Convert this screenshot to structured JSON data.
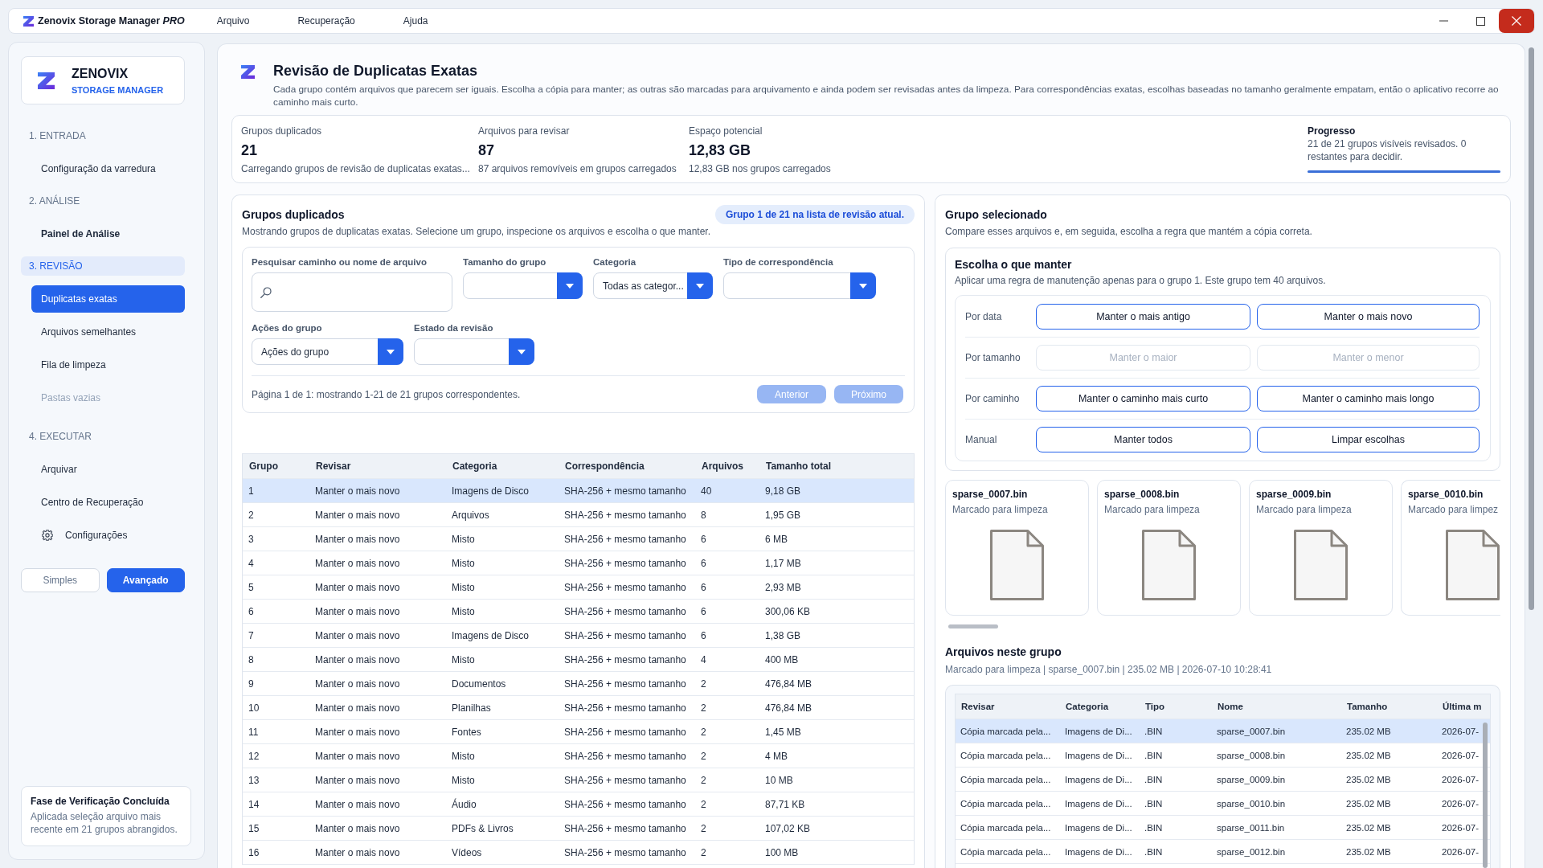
{
  "window": {
    "title": "Zenovix Storage Manager *PRO*",
    "menu": [
      "Arquivo",
      "Recuperação",
      "Ajuda"
    ]
  },
  "sidebar": {
    "brand": {
      "name": "ZENOVIX",
      "tagline": "STORAGE MANAGER"
    },
    "sections": [
      {
        "label": "1. ENTRADA",
        "selected": false,
        "items": [
          {
            "label": "Configuração da varredura",
            "kind": "page",
            "selected": false,
            "disabled": false,
            "emphasized": false
          }
        ]
      },
      {
        "label": "2. ANÁLISE",
        "selected": false,
        "items": [
          {
            "label": "Painel de Análise",
            "kind": "page",
            "selected": false,
            "disabled": false,
            "emphasized": true
          }
        ]
      },
      {
        "label": "3. REVISÃO",
        "selected": true,
        "items": [
          {
            "label": "Duplicatas exatas",
            "kind": "page",
            "selected": true,
            "disabled": false,
            "emphasized": false
          },
          {
            "label": "Arquivos semelhantes",
            "kind": "page",
            "selected": false,
            "disabled": false,
            "emphasized": false
          },
          {
            "label": "Fila de limpeza",
            "kind": "page",
            "selected": false,
            "disabled": false,
            "emphasized": false
          },
          {
            "label": "Pastas vazias",
            "kind": "page",
            "selected": false,
            "disabled": true,
            "emphasized": false
          }
        ]
      },
      {
        "label": "4. EXECUTAR",
        "selected": false,
        "items": [
          {
            "label": "Arquivar",
            "kind": "page",
            "selected": false,
            "disabled": false,
            "emphasized": false
          },
          {
            "label": "Centro de Recuperação",
            "kind": "page",
            "selected": false,
            "disabled": false,
            "emphasized": false
          },
          {
            "label": "Configurações",
            "kind": "settings",
            "selected": false,
            "disabled": false,
            "emphasized": false
          }
        ]
      }
    ],
    "modes": [
      {
        "label": "Simples",
        "selected": false
      },
      {
        "label": "Avançado",
        "selected": true
      }
    ],
    "status_card": {
      "title": "Fase de Verificação Concluída",
      "text": "Aplicada seleção arquivo mais recente em 21 grupos abrangidos."
    }
  },
  "header": {
    "title": "Revisão de Duplicatas Exatas",
    "description": "Cada grupo contém arquivos que parecem ser iguais. Escolha a cópia para manter; as outras são marcadas para arquivamento e ainda podem ser revisadas antes da limpeza. Para correspondências exatas, escolhas baseadas no tamanho geralmente empatam, então o aplicativo recorre ao caminho mais curto."
  },
  "stats": [
    {
      "label": "Grupos duplicados",
      "value": "21",
      "note": "Carregando grupos de revisão de duplicatas exatas..."
    },
    {
      "label": "Arquivos para revisar",
      "value": "87",
      "note": "87 arquivos removíveis em grupos carregados"
    },
    {
      "label": "Espaço potencial",
      "value": "12,83 GB",
      "note": "12,83 GB nos grupos carregados"
    }
  ],
  "progress": {
    "label": "Progresso",
    "text": "21 de 21 grupos visíveis revisados. 0 restantes para decidir.",
    "level": 1
  },
  "groups_panel": {
    "title": "Grupos duplicados",
    "badge": "Grupo 1 de 21 na lista de revisão atual.",
    "description": "Mostrando grupos de duplicatas exatas. Selecione um grupo, inspecione os arquivos e escolha o que manter.",
    "filters": [
      {
        "label": "Pesquisar caminho ou nome de arquivo",
        "kind": "search"
      },
      {
        "label": "Tamanho do grupo",
        "kind": "dropdown"
      },
      {
        "label": "Categoria",
        "kind": "dropdown",
        "value": "Todas as categor..."
      },
      {
        "label": "Tipo de correspondência",
        "kind": "dropdown"
      },
      {
        "label": "Ações do grupo",
        "kind": "dropdown",
        "value": "Ações do grupo"
      },
      {
        "label": "Estado da revisão",
        "kind": "dropdown"
      }
    ],
    "page_info": "Página 1 de 1: mostrando 1-21 de 21 grupos correspondentes.",
    "pager": [
      {
        "label": "Anterior",
        "disabled": true
      },
      {
        "label": "Próximo",
        "disabled": true
      }
    ],
    "table": {
      "columns": [
        "Grupo",
        "Revisar",
        "Categoria",
        "Correspondência",
        "Arquivos",
        "Tamanho total"
      ],
      "rows": [
        {
          "selected": true,
          "cells": [
            "1",
            "Manter o mais novo",
            "Imagens de Disco",
            "SHA-256 + mesmo tamanho",
            "40",
            "9,18 GB"
          ]
        },
        {
          "selected": false,
          "cells": [
            "2",
            "Manter o mais novo",
            "Arquivos",
            "SHA-256 + mesmo tamanho",
            "8",
            "1,95 GB"
          ]
        },
        {
          "selected": false,
          "cells": [
            "3",
            "Manter o mais novo",
            "Misto",
            "SHA-256 + mesmo tamanho",
            "6",
            "6 MB"
          ]
        },
        {
          "selected": false,
          "cells": [
            "4",
            "Manter o mais novo",
            "Misto",
            "SHA-256 + mesmo tamanho",
            "6",
            "1,17 MB"
          ]
        },
        {
          "selected": false,
          "cells": [
            "5",
            "Manter o mais novo",
            "Misto",
            "SHA-256 + mesmo tamanho",
            "6",
            "2,93 MB"
          ]
        },
        {
          "selected": false,
          "cells": [
            "6",
            "Manter o mais novo",
            "Misto",
            "SHA-256 + mesmo tamanho",
            "6",
            "300,06 KB"
          ]
        },
        {
          "selected": false,
          "cells": [
            "7",
            "Manter o mais novo",
            "Imagens de Disco",
            "SHA-256 + mesmo tamanho",
            "6",
            "1,38 GB"
          ]
        },
        {
          "selected": false,
          "cells": [
            "8",
            "Manter o mais novo",
            "Misto",
            "SHA-256 + mesmo tamanho",
            "4",
            "400 MB"
          ]
        },
        {
          "selected": false,
          "cells": [
            "9",
            "Manter o mais novo",
            "Documentos",
            "SHA-256 + mesmo tamanho",
            "2",
            "476,84 MB"
          ]
        },
        {
          "selected": false,
          "cells": [
            "10",
            "Manter o mais novo",
            "Planilhas",
            "SHA-256 + mesmo tamanho",
            "2",
            "476,84 MB"
          ]
        },
        {
          "selected": false,
          "cells": [
            "11",
            "Manter o mais novo",
            "Fontes",
            "SHA-256 + mesmo tamanho",
            "2",
            "1,45 MB"
          ]
        },
        {
          "selected": false,
          "cells": [
            "12",
            "Manter o mais novo",
            "Misto",
            "SHA-256 + mesmo tamanho",
            "2",
            "4 MB"
          ]
        },
        {
          "selected": false,
          "cells": [
            "13",
            "Manter o mais novo",
            "Misto",
            "SHA-256 + mesmo tamanho",
            "2",
            "10 MB"
          ]
        },
        {
          "selected": false,
          "cells": [
            "14",
            "Manter o mais novo",
            "Áudio",
            "SHA-256 + mesmo tamanho",
            "2",
            "87,71 KB"
          ]
        },
        {
          "selected": false,
          "cells": [
            "15",
            "Manter o mais novo",
            "PDFs & Livros",
            "SHA-256 + mesmo tamanho",
            "2",
            "107,02 KB"
          ]
        },
        {
          "selected": false,
          "cells": [
            "16",
            "Manter o mais novo",
            "Vídeos",
            "SHA-256 + mesmo tamanho",
            "2",
            "100 MB"
          ]
        }
      ]
    }
  },
  "selected_group": {
    "title": "Grupo selecionado",
    "description": "Compare esses arquivos e, em seguida, escolha a regra que mantém a cópia correta.",
    "keep": {
      "title": "Escolha o que manter",
      "description": "Aplicar uma regra de manutenção apenas para o grupo 1. Este grupo tem 40 arquivos.",
      "rules": [
        {
          "label": "Por data",
          "options": [
            {
              "label": "Manter o mais antigo",
              "disabled": false
            },
            {
              "label": "Manter o mais novo",
              "disabled": false
            }
          ]
        },
        {
          "label": "Por tamanho",
          "options": [
            {
              "label": "Manter o maior",
              "disabled": true
            },
            {
              "label": "Manter o menor",
              "disabled": true
            }
          ]
        },
        {
          "label": "Por caminho",
          "options": [
            {
              "label": "Manter o caminho mais curto",
              "disabled": false
            },
            {
              "label": "Manter o caminho mais longo",
              "disabled": false
            }
          ]
        },
        {
          "label": "Manual",
          "options": [
            {
              "label": "Manter todos",
              "disabled": false
            },
            {
              "label": "Limpar escolhas",
              "disabled": false
            }
          ]
        }
      ]
    },
    "file_cards": [
      {
        "name": "sparse_0007.bin",
        "status": "Marcado para limpeza"
      },
      {
        "name": "sparse_0008.bin",
        "status": "Marcado para limpeza"
      },
      {
        "name": "sparse_0009.bin",
        "status": "Marcado para limpeza"
      },
      {
        "name": "sparse_0010.bin",
        "status": "Marcado para limpez"
      }
    ],
    "files": {
      "title": "Arquivos neste grupo",
      "summary": "Marcado para limpeza | sparse_0007.bin | 235.02 MB | 2026-07-10 10:28:41",
      "table": {
        "columns": [
          "Revisar",
          "Categoria",
          "Tipo",
          "Nome",
          "Tamanho",
          "Última m"
        ],
        "rows": [
          {
            "selected": true,
            "cells": [
              "Cópia marcada pela...",
              "Imagens de Di...",
              ".BIN",
              "sparse_0007.bin",
              "235.02 MB",
              "2026-07-"
            ]
          },
          {
            "selected": false,
            "cells": [
              "Cópia marcada pela...",
              "Imagens de Di...",
              ".BIN",
              "sparse_0008.bin",
              "235.02 MB",
              "2026-07-"
            ]
          },
          {
            "selected": false,
            "cells": [
              "Cópia marcada pela...",
              "Imagens de Di...",
              ".BIN",
              "sparse_0009.bin",
              "235.02 MB",
              "2026-07-"
            ]
          },
          {
            "selected": false,
            "cells": [
              "Cópia marcada pela...",
              "Imagens de Di...",
              ".BIN",
              "sparse_0010.bin",
              "235.02 MB",
              "2026-07-"
            ]
          },
          {
            "selected": false,
            "cells": [
              "Cópia marcada pela...",
              "Imagens de Di...",
              ".BIN",
              "sparse_0011.bin",
              "235.02 MB",
              "2026-07-"
            ]
          },
          {
            "selected": false,
            "cells": [
              "Cópia marcada pela...",
              "Imagens de Di...",
              ".BIN",
              "sparse_0012.bin",
              "235.02 MB",
              "2026-07-"
            ]
          }
        ]
      }
    }
  }
}
